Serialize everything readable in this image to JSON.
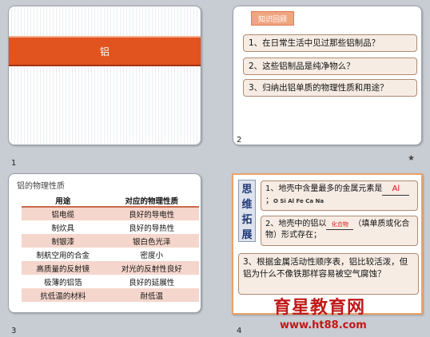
{
  "slides": [
    {
      "number": "1",
      "title": "铝"
    },
    {
      "number": "2",
      "tag": "知识回顾",
      "questions": [
        "1、在日常生活中见过那些铝制品？",
        "2、这些铝制品是纯净物么？",
        "3、归纳出铝单质的物理性质和用途？"
      ]
    },
    {
      "number": "3",
      "title": "铝的物理性质",
      "headers": [
        "用途",
        "对应的物理性质"
      ],
      "rows": [
        [
          "铝电缆",
          "良好的导电性"
        ],
        [
          "制炊具",
          "良好的导热性"
        ],
        [
          "制银漆",
          "银白色光泽"
        ],
        [
          "制航空用的合金",
          "密度小"
        ],
        [
          "高质量的反射镜",
          "对光的反射性良好"
        ],
        [
          "极薄的铝箔",
          "良好的延展性"
        ],
        [
          "抗低温的材料",
          "耐低温"
        ]
      ]
    },
    {
      "number": "4",
      "side_label": [
        "思",
        "维",
        "拓",
        "展"
      ],
      "q1_text": "1、地壳中含量最多的金属元素是",
      "q1_answer": "Al",
      "q1_suffix": "；",
      "q1_small": "O Si Al Fe Ca Na",
      "q2_prefix": "2、地壳中的铝以",
      "q2_answer": "化合物",
      "q2_suffix": "（填单质或化合物）形式存在；",
      "q3_text": "3、根据金属活动性顺序表，铝比较活泼，但铝为什么不像铁那样容易被空气腐蚀？"
    }
  ],
  "watermark": {
    "text": "育星教育网",
    "url": "www.ht88.com"
  },
  "star_icon": "star-icon"
}
